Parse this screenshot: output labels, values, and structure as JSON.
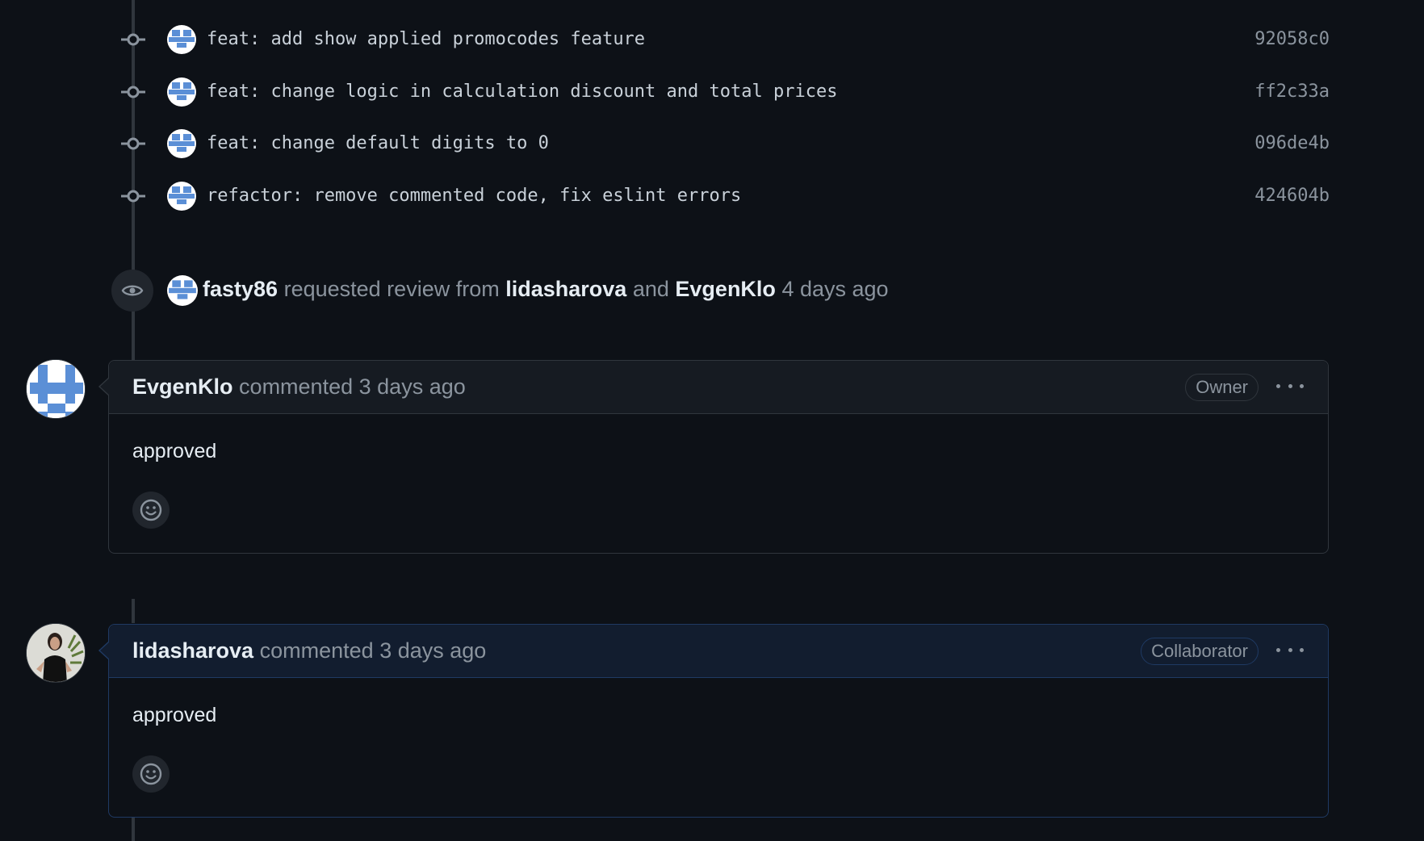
{
  "commits": [
    {
      "message": "feat: add show applied promocodes feature",
      "sha": "92058c0"
    },
    {
      "message": "feat: change logic in calculation discount and total prices",
      "sha": "ff2c33a"
    },
    {
      "message": "feat: change default digits to 0",
      "sha": "096de4b"
    },
    {
      "message": "refactor: remove commented code, fix eslint errors",
      "sha": "424604b"
    }
  ],
  "review_event": {
    "actor": "fasty86",
    "action": "requested review from",
    "reviewer1": "lidasharova",
    "conjunction": "and",
    "reviewer2": "EvgenKlo",
    "time": "4 days ago"
  },
  "comments": [
    {
      "author": "EvgenKlo",
      "verb": "commented",
      "time": "3 days ago",
      "role": "Owner",
      "body": "approved"
    },
    {
      "author": "lidasharova",
      "verb": "commented",
      "time": "3 days ago",
      "role": "Collaborator",
      "body": "approved"
    }
  ],
  "colors": {
    "background": "#0d1117",
    "avatar_blue": "#5b8fd6",
    "highlight_border": "#1f3a63"
  }
}
